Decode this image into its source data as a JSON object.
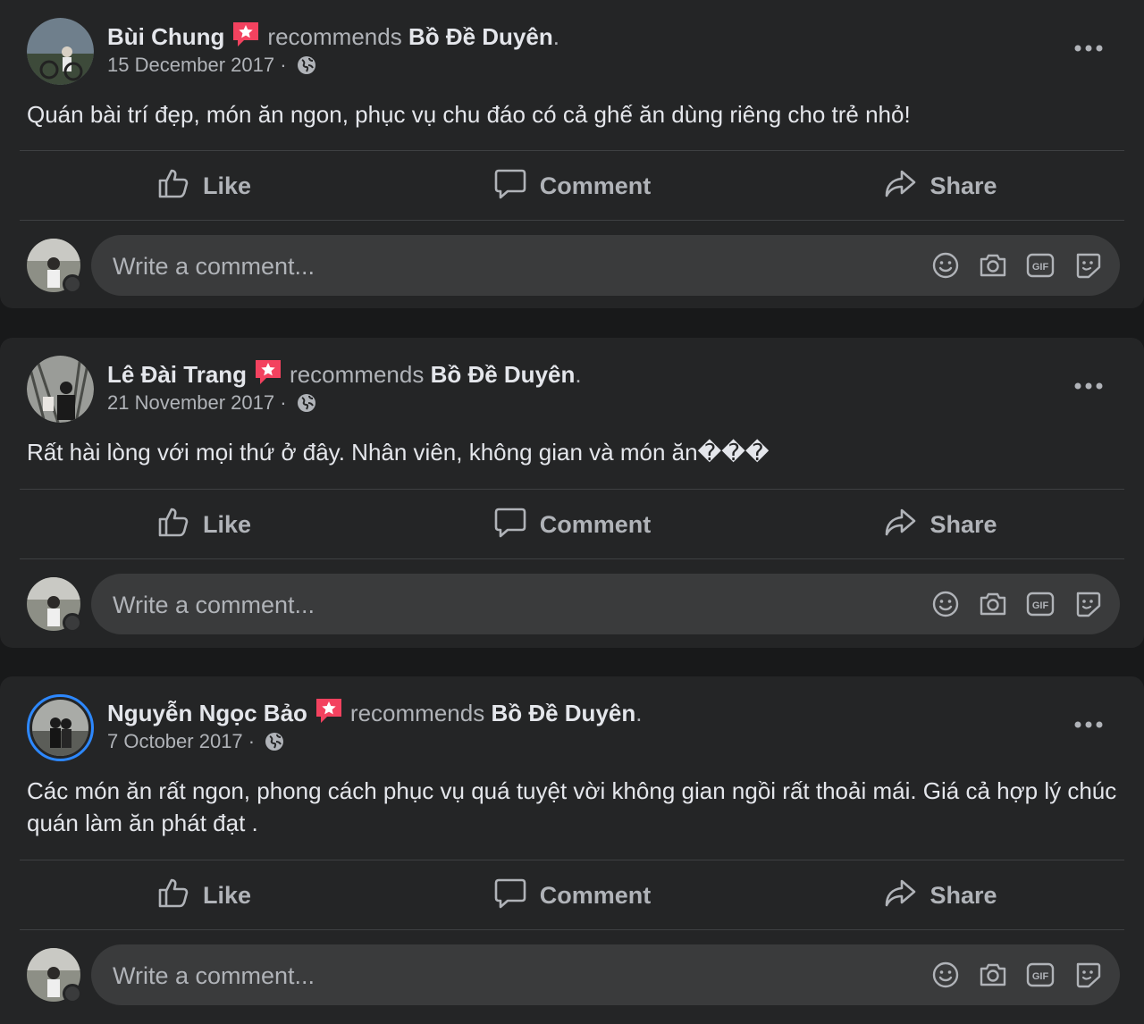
{
  "posts": [
    {
      "author": "Bùi Chung",
      "recommends_text": "recommends",
      "page": "Bồ Đề Duyên",
      "date": "15 December 2017",
      "date_sep": "·",
      "text": "Quán bài trí đẹp, món ăn ngon, phục vụ chu đáo có cả ghế ăn dùng riêng cho trẻ nhỏ!"
    },
    {
      "author": "Lê Đài Trang",
      "recommends_text": "recommends",
      "page": "Bồ Đề Duyên",
      "date": "21 November 2017",
      "date_sep": "·",
      "text": "Rất hài lòng với mọi thứ ở đây. Nhân viên, không gian và món ăn���"
    },
    {
      "author": "Nguyễn Ngọc Bảo",
      "recommends_text": "recommends",
      "page": "Bồ Đề Duyên",
      "date": "7 October 2017",
      "date_sep": "·",
      "text": "Các món ăn rất ngon, phong cách phục vụ quá tuyệt vời không gian ngồi rất thoải mái. Giá cả hợp lý chúc quán làm ăn phát đạt ."
    }
  ],
  "actions": {
    "like": "Like",
    "comment": "Comment",
    "share": "Share"
  },
  "composer": {
    "placeholder": "Write a comment..."
  },
  "icons": {
    "recommend": "recommend-star-badge-icon",
    "privacy": "globe-icon",
    "more": "more-options-icon",
    "like": "thumbs-up-icon",
    "comment": "speech-bubble-icon",
    "share": "share-arrow-icon",
    "emoji": "emoji-icon",
    "camera": "camera-icon",
    "gif": "gif-icon",
    "sticker": "sticker-icon"
  },
  "colors": {
    "page_bg": "#18191a",
    "card_bg": "#242526",
    "input_bg": "#3a3b3c",
    "primary_text": "#e4e6eb",
    "secondary_text": "#b0b3b8",
    "recommend_badge": "#f3425f",
    "story_ring": "#2d88ff"
  }
}
